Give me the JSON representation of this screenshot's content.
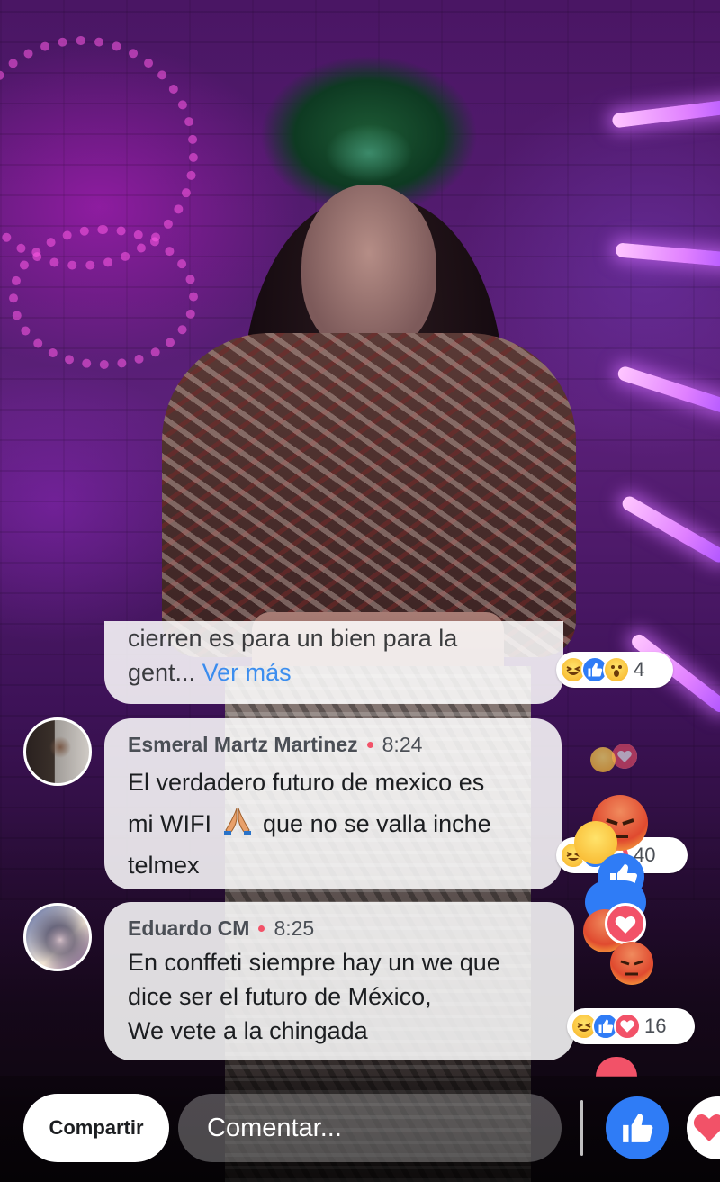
{
  "comments": [
    {
      "text_line1": "cierren es para un bien para la",
      "text_line2": "gent...",
      "see_more": "Ver más",
      "reaction_count": "4"
    },
    {
      "author": "Esmeral Martz Martinez",
      "time": "8:24",
      "text_line1": "El  verdadero futuro de mexico es",
      "text_line2_before": "mi WIFI",
      "text_line2_after": "que no se valla inche",
      "text_line3": "telmex",
      "reaction_count": "40"
    },
    {
      "author": "Eduardo CM",
      "time": "8:25",
      "text_line1": "En conffeti siempre hay un we que",
      "text_line2": "dice ser el futuro de México,",
      "text_line3": "We vete a la chingada",
      "reaction_count": "16"
    }
  ],
  "bottom_bar": {
    "share_label": "Compartir",
    "comment_placeholder": "Comentar..."
  },
  "colors": {
    "like_blue": "#2f7cf6",
    "love_red": "#f25268",
    "see_more_blue": "#1e7ef0",
    "live_dot": "#f25268"
  },
  "icons": [
    "prayer-hands-icon",
    "like-icon",
    "love-icon",
    "haha-icon",
    "wow-icon",
    "angry-icon"
  ]
}
